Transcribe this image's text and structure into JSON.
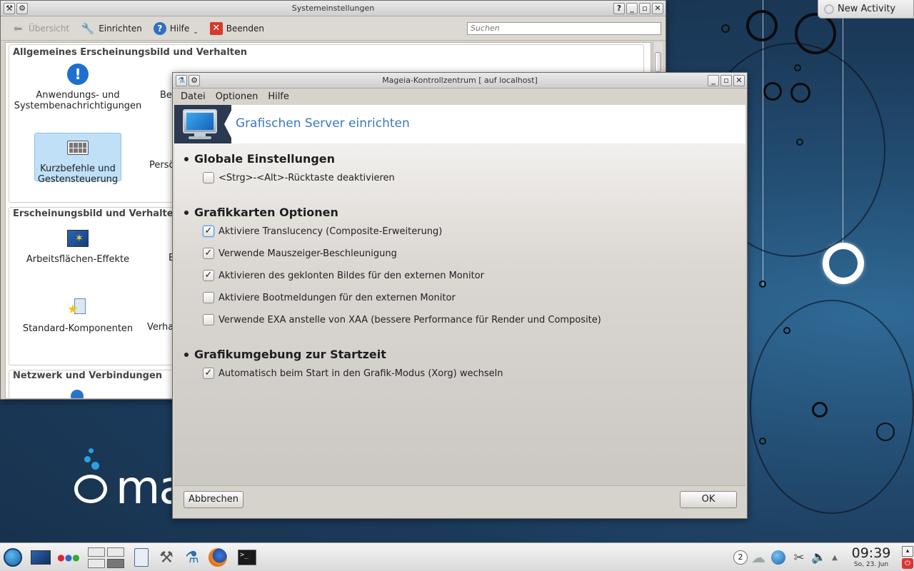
{
  "desktop": {
    "new_activity_label": "New Activity",
    "logo_text": "ma"
  },
  "sys_window": {
    "title": "Systemeinstellungen",
    "toolbar": {
      "overview_label": "Übersicht",
      "configure_label": "Einrichten",
      "help_label": "Hilfe",
      "quit_label": "Beenden",
      "search_placeholder": "Suchen"
    },
    "sections": [
      {
        "title": "Allgemeines Erscheinungsbild und Verhalten",
        "modules": [
          {
            "label": "Anwendungs- und\nSystembenachrichtigungen"
          },
          {
            "label": "Be"
          },
          {
            "label": "Kurzbefehle und\nGestensteuerung"
          },
          {
            "label": "Persö"
          }
        ]
      },
      {
        "title": "Erscheinungsbild und Verhalten",
        "modules": [
          {
            "label": "Arbeitsflächen-Effekte"
          },
          {
            "label": "E"
          },
          {
            "label": "Standard-Komponenten"
          },
          {
            "label": "Verha"
          }
        ]
      },
      {
        "title": "Netzwerk und Verbindungen",
        "modules": []
      }
    ]
  },
  "mcc_window": {
    "title": "Mageia-Kontrollzentrum  [ auf localhost]",
    "menu": [
      "Datei",
      "Optionen",
      "Hilfe"
    ],
    "header_title": "Grafischen Server einrichten",
    "groups": [
      {
        "title": "Globale Einstellungen",
        "options": [
          {
            "label": "<Strg>-<Alt>-Rücktaste deaktivieren",
            "checked": false
          }
        ]
      },
      {
        "title": "Grafikkarten Optionen",
        "options": [
          {
            "label": "Aktiviere Translucency (Composite-Erweiterung)",
            "checked": true
          },
          {
            "label": "Verwende Mauszeiger-Beschleunigung",
            "checked": true
          },
          {
            "label": "Aktivieren des geklonten Bildes für den externen Monitor",
            "checked": true
          },
          {
            "label": "Aktiviere Bootmeldungen für den externen Monitor",
            "checked": false
          },
          {
            "label": "Verwende EXA anstelle von XAA (bessere Performance für Render und Composite)",
            "checked": false
          }
        ]
      },
      {
        "title": "Grafikumgebung zur Startzeit",
        "options": [
          {
            "label": "Automatisch beim Start in den Grafik-Modus (Xorg) wechseln",
            "checked": true
          }
        ]
      }
    ],
    "cancel_label": "Abbrechen",
    "ok_label": "OK"
  },
  "taskbar": {
    "pager_number": "2",
    "time": "09:39",
    "date": "So, 23. Jun"
  }
}
